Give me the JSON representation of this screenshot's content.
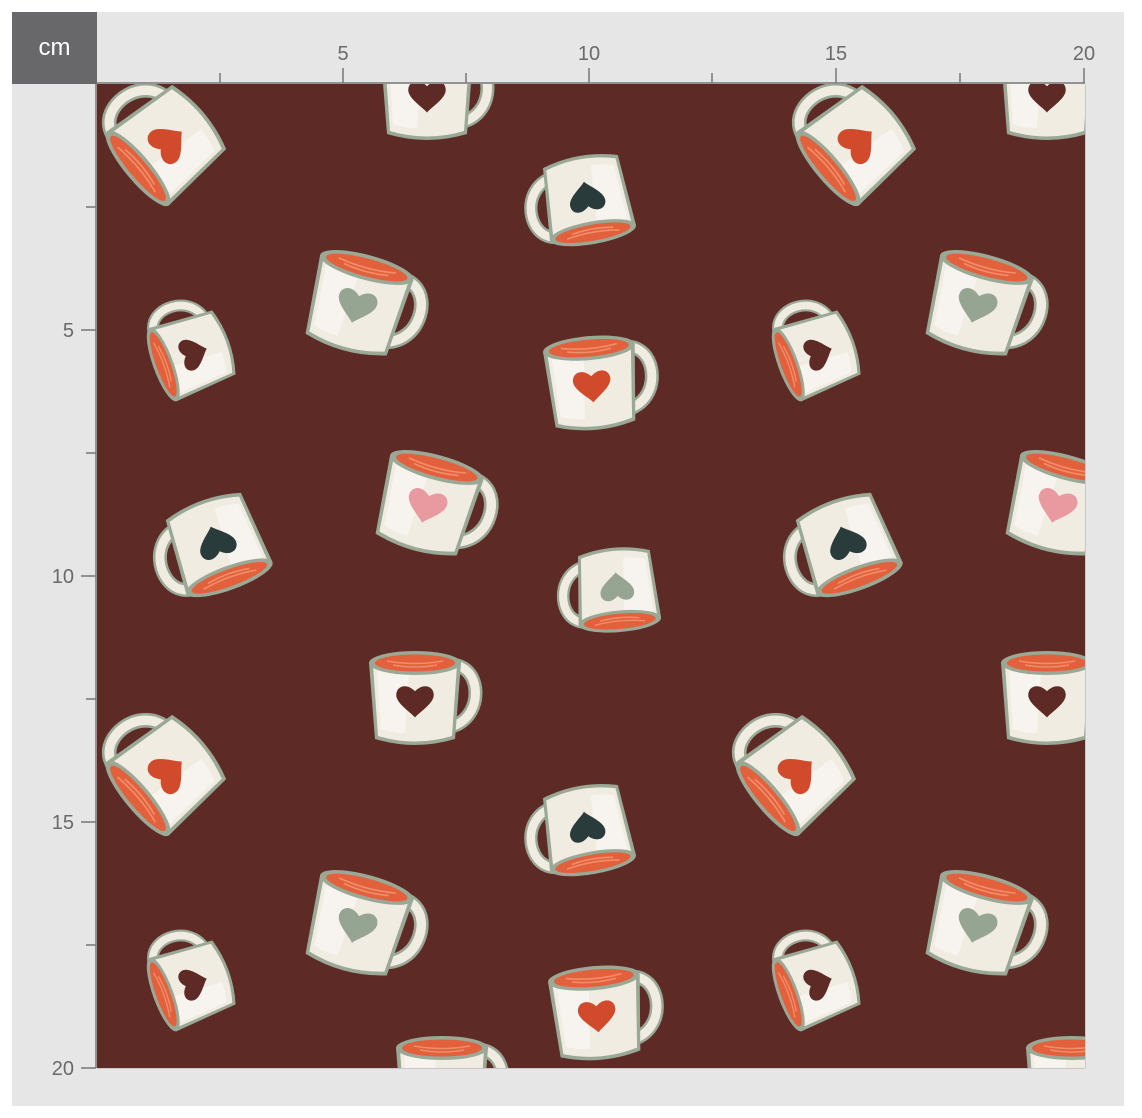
{
  "ruler": {
    "unit": "cm",
    "x_labels": [
      "5",
      "10",
      "15",
      "20"
    ],
    "y_labels": [
      "5",
      "10",
      "15",
      "20"
    ]
  },
  "pattern": {
    "motif": "coffee-mug-icon",
    "background_color": "#5e2a25",
    "mug_color": "#f1ece2",
    "mug_shadow_color": "#9aa896",
    "drink_color": "#e3603d",
    "heart_colors": [
      "#d24a2c",
      "#2a3b3b",
      "#96a492",
      "#e99aa0",
      "#5e2a25"
    ]
  }
}
